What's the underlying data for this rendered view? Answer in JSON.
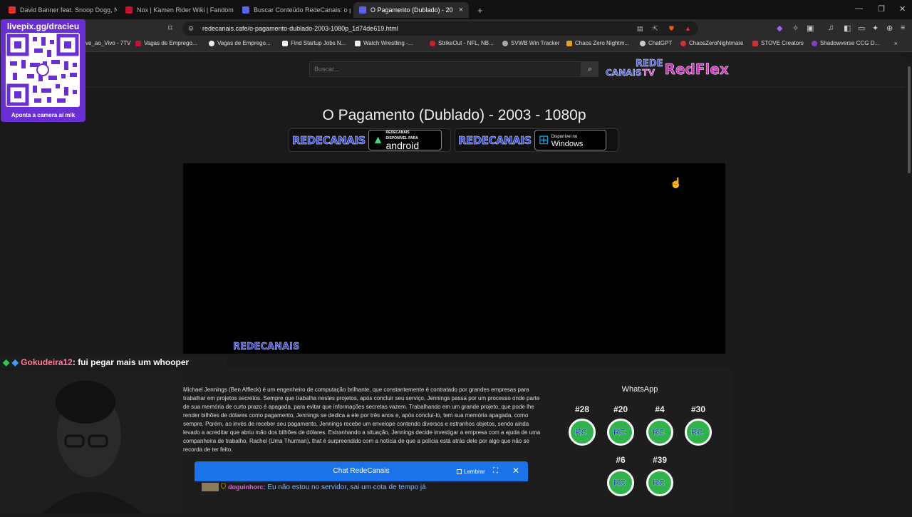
{
  "browser": {
    "tabs": [
      {
        "label": "David Banner feat. Snoop Dogg, Nip",
        "color": "#e52d27"
      },
      {
        "label": "Nox | Kamen Rider Wiki | Fandom",
        "color": "#c41230"
      },
      {
        "label": "Buscar Conteúdo RedeCanais: o pag",
        "color": "#5865f2"
      },
      {
        "label": "O Pagamento (Dublado) - 20",
        "color": "#5865f2"
      }
    ],
    "url": "redecanais.cafe/o-pagamento-dublado-2003-1080p_1d74de619.html",
    "bookmarks": [
      "ve_ao_Vivo - 7TV",
      "Vagas de Emprego...",
      "Vagas de Emprego...",
      "Find Startup Jobs N...",
      "Watch Wrestling -...",
      "StrikeOut - NFL, NB...",
      "SVWB Win Tracker",
      "Chaos Zero Nightm...",
      "ChatGPT",
      "ChaosZeroNightmare",
      "STOVE Creators",
      "Shadowverse CCG D..."
    ]
  },
  "site": {
    "search_placeholder": "Buscar...",
    "logo_top": "REDE",
    "logo_bottom": "CANAIS",
    "logo_tv": "TV",
    "logo_extra": "RedFlex",
    "title": "O Pagamento (Dublado) - 2003 - 1080p",
    "badge_brand": "REDECANAIS",
    "android_small1": "REDECANAIS",
    "android_small2": "DISPONÍVEL PARA",
    "android_label": "android",
    "windows_small": "Disponível no",
    "windows_label": "Windows",
    "player_logo": "REDECANAIS",
    "description": "Michael Jennings (Ben Affleck) é um engenheiro de computação brilhante, que constantemente é contratado por grandes empresas para trabalhar em projetos secretos. Sempre que trabalha nestes projetos, após concluir seu serviço, Jennings passa por um processo onde parte de sua memória de curto prazo é apagada, para evitar que informações secretas vazem. Trabalhando em um grande projeto, que pode lhe render bilhões de dólares como pagamento, Jennings se dedica a ele por três anos e, após concluí-lo, tem sua memória apagada, como sempre. Porém, ao invés de receber seu pagamento, Jennings recebe um envelope contendo diversos e estranhos objetos, sendo ainda levado a acreditar que abriu mão dos bilhões de dólares. Estranhando a situação, Jennings decide investigar a empresa com a ajuda de uma companheira de trabalho, Rachel (Uma Thurman), that é surpreendido com a notícia de que a polícia está atrás dele por algo que não se recorda de ter feito.",
    "whatsapp_title": "WhatsApp",
    "whatsapp_groups": [
      "#28",
      "#20",
      "#4",
      "#30",
      "#6",
      "#39"
    ],
    "wa_icon_text": "RC",
    "chat": {
      "title": "Chat RedeCanais",
      "remember": "Lembrar",
      "close": "✕",
      "expand": "⛶",
      "msg_user": "doguinhorc:",
      "msg_text": "Eu não estou no servidor, sai um cota de tempo já"
    }
  },
  "overlay": {
    "qr_handle": "livepix.gg/dracieu",
    "qr_caption": "Aponta a camera aí mlk",
    "chat_user": "Gokudeira12",
    "chat_text": ": fui pegar mais um whooper"
  }
}
